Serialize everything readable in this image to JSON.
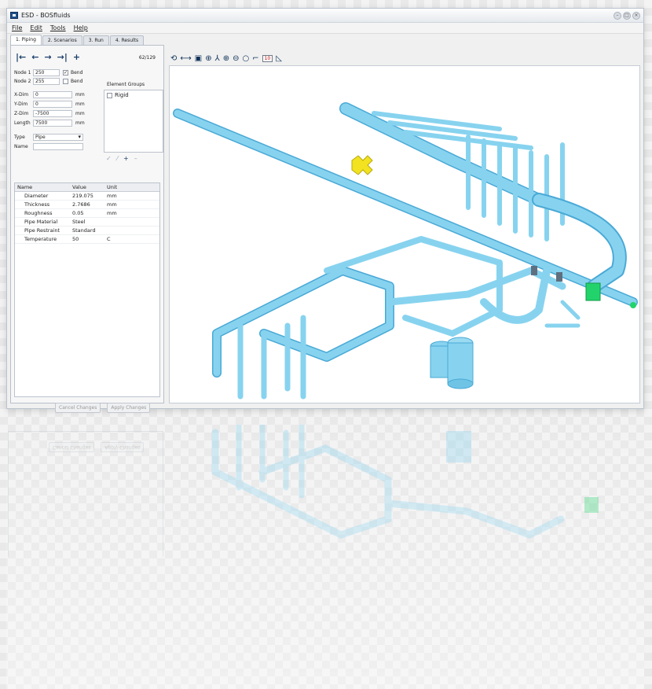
{
  "window": {
    "title": "ESD - BOSfluids"
  },
  "menu": [
    "File",
    "Edit",
    "Tools",
    "Help"
  ],
  "tabs": [
    {
      "label": "1. Piping"
    },
    {
      "label": "2. Scenarios"
    },
    {
      "label": "3. Run"
    },
    {
      "label": "4. Results"
    }
  ],
  "navigator": {
    "count": "62/129",
    "icons": [
      "first-icon",
      "prev-icon",
      "next-icon",
      "last-icon",
      "add-icon"
    ]
  },
  "node": {
    "node1_label": "Node 1",
    "node1_value": "250",
    "node1_bend_label": "Bend",
    "node1_bend_checked": true,
    "node2_label": "Node 2",
    "node2_value": "255",
    "node2_bend_label": "Bend",
    "node2_bend_checked": false
  },
  "dims": {
    "xdim_label": "X-Dim",
    "xdim_value": "0",
    "xdim_unit": "mm",
    "ydim_label": "Y-Dim",
    "ydim_value": "0",
    "ydim_unit": "mm",
    "zdim_label": "Z-Dim",
    "zdim_value": "-7500",
    "zdim_unit": "mm",
    "length_label": "Length",
    "length_value": "7500",
    "length_unit": "mm"
  },
  "type": {
    "label": "Type",
    "value": "Pipe",
    "name_label": "Name",
    "name_value": ""
  },
  "element_groups": {
    "title": "Element Groups",
    "items": [
      {
        "label": "Rigid",
        "checked": false
      }
    ],
    "tools": [
      "check-icon",
      "edit-icon",
      "plus-icon",
      "minus-icon"
    ]
  },
  "properties": {
    "headers": [
      "Name",
      "Value",
      "Unit"
    ],
    "rows": [
      {
        "name": "Diameter",
        "value": "219.075",
        "unit": "mm"
      },
      {
        "name": "Thickness",
        "value": "2.7686",
        "unit": "mm"
      },
      {
        "name": "Roughness",
        "value": "0.05",
        "unit": "mm"
      },
      {
        "name": "Pipe Material",
        "value": "Steel",
        "unit": ""
      },
      {
        "name": "Pipe Restraint",
        "value": "Standard",
        "unit": ""
      },
      {
        "name": "Temperature",
        "value": "50",
        "unit": "C"
      }
    ]
  },
  "buttons": {
    "cancel": "Cancel Changes",
    "apply": "Apply Changes"
  },
  "toolbar": {
    "zoom_box": "10",
    "icons": [
      "rotate-icon",
      "pan-icon",
      "view-cube-icon",
      "center-icon",
      "axes-icon",
      "zoom-in-icon",
      "zoom-out-icon",
      "zoom-fit-icon",
      "step-icon",
      "scale-icon",
      "measure-icon"
    ]
  },
  "colors": {
    "pipe": "#87d3ef",
    "pipe_edge": "#4aa9d6",
    "valve": "#f2e21f",
    "marker": "#22d36b"
  }
}
